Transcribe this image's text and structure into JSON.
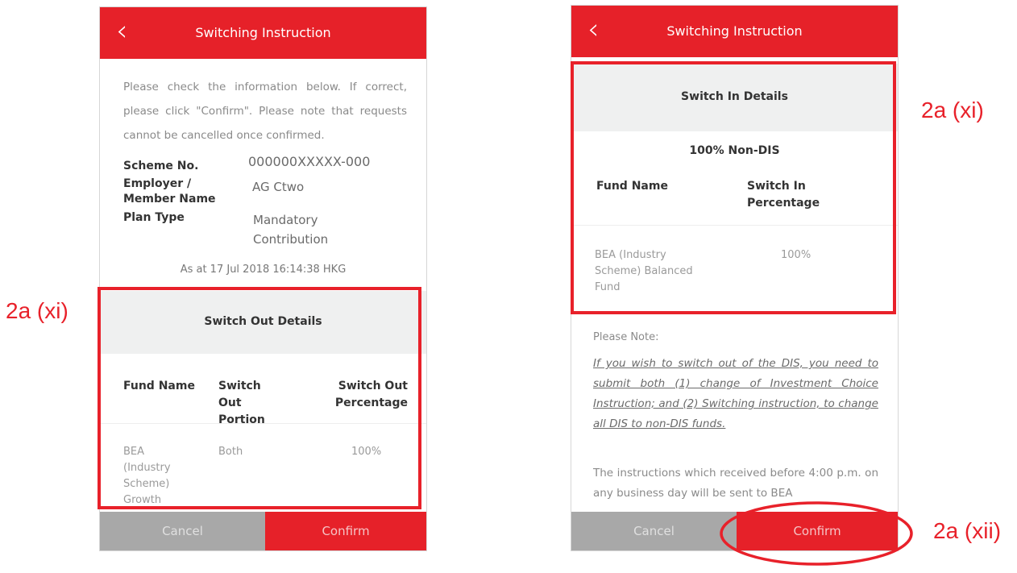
{
  "left_screen": {
    "header_title": "Switching Instruction",
    "intro_text": "Please check the information below. If correct, please click \"Confirm\". Please note that requests cannot be cancelled once confirmed.",
    "scheme_no_label": "Scheme No.",
    "scheme_no_value": "000000XXXXX-000",
    "employer_label": "Employer / Member Name",
    "employer_value": "AG Ctwo",
    "plan_type_label": "Plan Type",
    "plan_type_value": "Mandatory Contribution",
    "as_at": "As at 17 Jul 2018 16:14:38 HKG",
    "section_title": "Switch Out Details",
    "col_fund_name": "Fund Name",
    "col_switch_out_portion": "Switch Out Portion",
    "col_switch_out_percentage": "Switch Out Percentage",
    "row_fund_name": "BEA (Industry Scheme) Growth",
    "row_portion": "Both",
    "row_percentage": "100%",
    "cancel_label": "Cancel",
    "confirm_label": "Confirm"
  },
  "right_screen": {
    "header_title": "Switching Instruction",
    "section_title": "Switch In Details",
    "allocation": "100% Non-DIS",
    "col_fund_name": "Fund Name",
    "col_switch_in_percentage": "Switch In Percentage",
    "row_fund_name": "BEA (Industry Scheme) Balanced Fund",
    "row_percentage": "100%",
    "note_title": "Please Note:",
    "note_italic": "If you wish to switch out of the DIS, you need to submit both (1) change of Investment Choice Instruction; and (2) Switching instruction, to change all DIS to non-DIS funds.",
    "note_normal": "The instructions which received before 4:00 p.m. on any business day will be sent to BEA",
    "cancel_label": "Cancel",
    "confirm_label": "Confirm"
  },
  "annotations": {
    "left_label": "2a (xi)",
    "right_label": "2a (xi)",
    "confirm_label": "2a (xii)",
    "color": "#e8212a"
  },
  "colors": {
    "brand_red": "#e62129",
    "cancel_gray": "#a8a8a8",
    "band_gray": "#eff0f0"
  }
}
